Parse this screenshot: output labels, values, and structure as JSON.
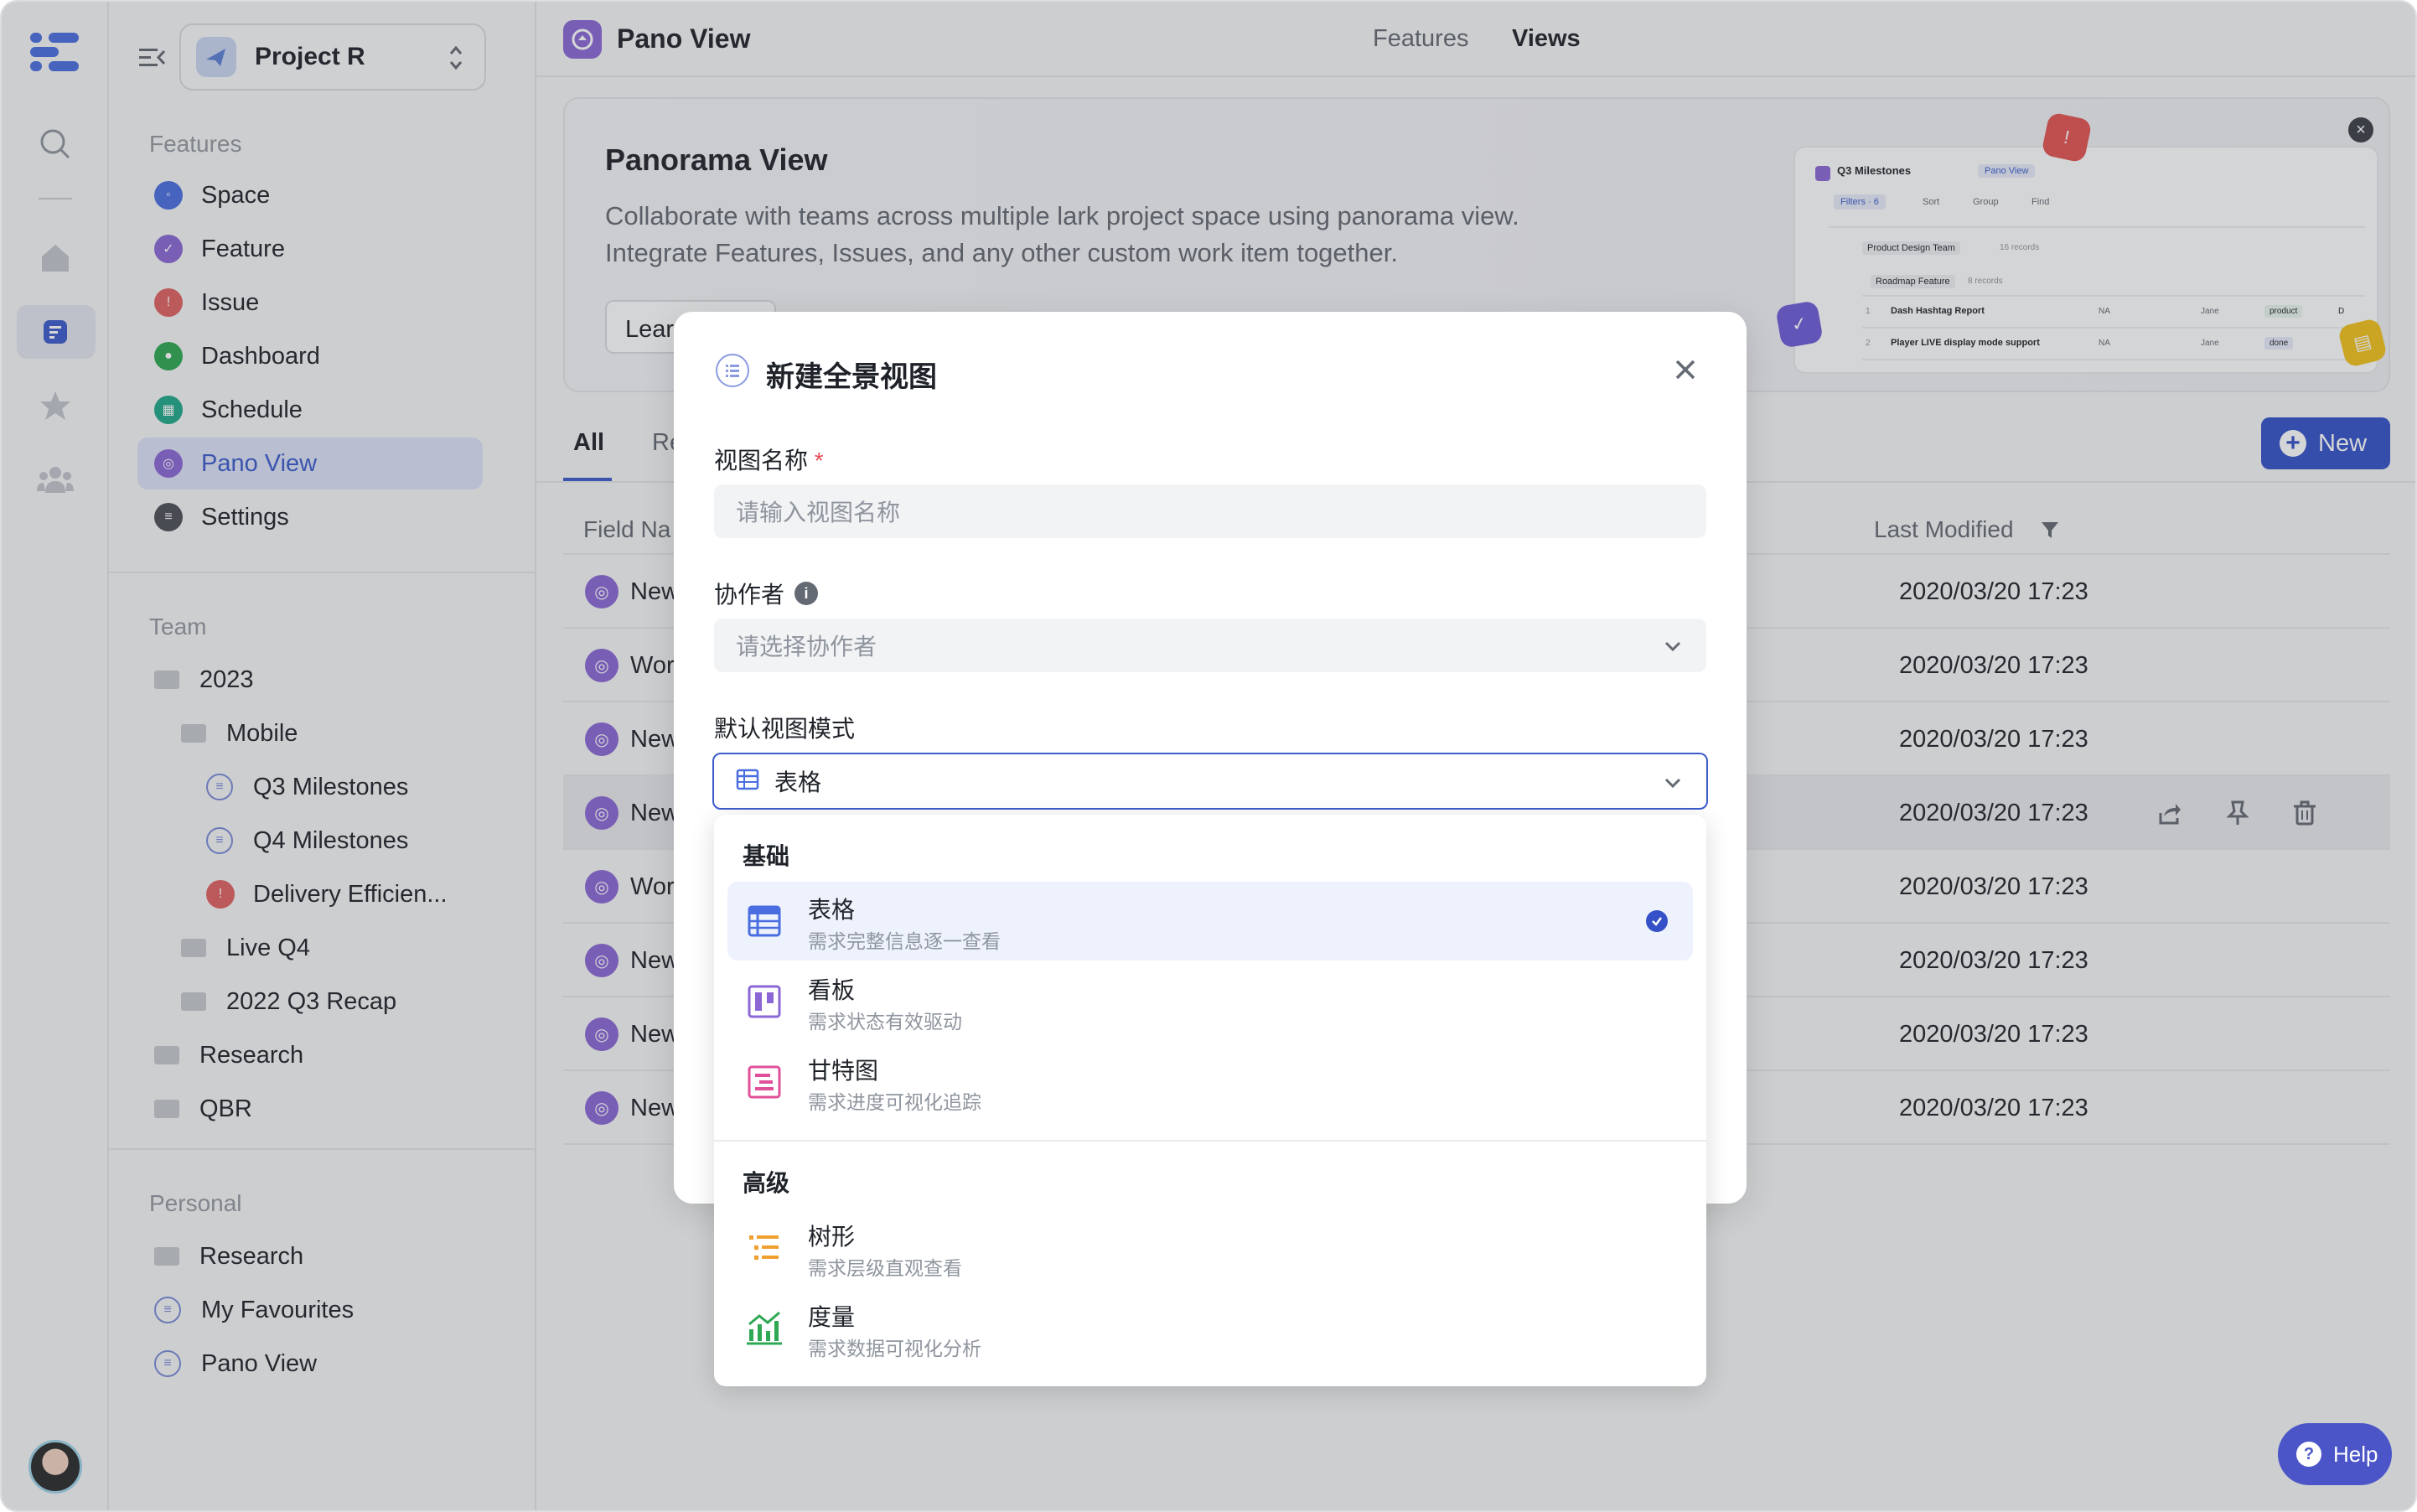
{
  "sidebar": {
    "project": "Project R",
    "features_header": "Features",
    "features": [
      {
        "label": "Space",
        "color": "#4a6ee0"
      },
      {
        "label": "Feature",
        "color": "#8b67d6"
      },
      {
        "label": "Issue",
        "color": "#e16060"
      },
      {
        "label": "Dashboard",
        "color": "#2ea853"
      },
      {
        "label": "Schedule",
        "color": "#1fa88a"
      },
      {
        "label": "Pano View",
        "color": "#8b67d6"
      },
      {
        "label": "Settings",
        "color": "#4c4f55"
      }
    ],
    "team_header": "Team",
    "team": {
      "y2023": "2023",
      "mobile": "Mobile",
      "q3": "Q3 Milestones",
      "q4": "Q4 Milestones",
      "delivery": "Delivery Efficien...",
      "live": "Live Q4",
      "recap": "2022 Q3 Recap",
      "research": "Research",
      "qbr": "QBR"
    },
    "personal_header": "Personal",
    "personal": {
      "research": "Research",
      "fav": "My Favourites",
      "pano": "Pano View"
    }
  },
  "topbar": {
    "title": "Pano View",
    "tab_features": "Features",
    "tab_views": "Views"
  },
  "banner": {
    "title": "Panorama View",
    "line1": "Collaborate with teams across multiple lark project space using panorama view.",
    "line2": "Integrate Features, Issues, and any other custom work item together.",
    "learn": "Lear",
    "preview": {
      "title": "Q3 Milestones",
      "badge": "Pano View",
      "filters": "Filters · 6",
      "sort": "Sort",
      "group": "Group",
      "find": "Find",
      "group1": "Product Design Team",
      "group1_count": "16 records",
      "group2": "Roadmap Feature",
      "group2_count": "8 records",
      "r1": "Dash Hashtag Report",
      "r2": "Player LIVE display mode support",
      "na": "NA",
      "jane": "Jane",
      "product": "product",
      "done": "done",
      "d": "D",
      "n1": "1",
      "n2": "2"
    }
  },
  "tabs": {
    "all": "All",
    "re": "Re"
  },
  "new_button": "New",
  "table": {
    "col_field": "Field Na",
    "col_modified": "Last Modified",
    "rows": [
      {
        "name": "New",
        "date": "2020/03/20 17:23"
      },
      {
        "name": "Wor",
        "date": "2020/03/20 17:23"
      },
      {
        "name": "New",
        "date": "2020/03/20 17:23"
      },
      {
        "name": "New",
        "date": "2020/03/20 17:23"
      },
      {
        "name": "Wor",
        "date": "2020/03/20 17:23"
      },
      {
        "name": "New",
        "date": "2020/03/20 17:23"
      },
      {
        "name": "New",
        "date": "2020/03/20 17:23"
      },
      {
        "name": "New",
        "date": "2020/03/20 17:23"
      }
    ]
  },
  "modal": {
    "title": "新建全景视图",
    "name_label": "视图名称",
    "required_mark": "*",
    "name_placeholder": "请输入视图名称",
    "collab_label": "协作者",
    "collab_placeholder": "请选择协作者",
    "mode_label": "默认视图模式",
    "mode_value": "表格"
  },
  "dropdown": {
    "basic": "基础",
    "advanced": "高级",
    "options": [
      {
        "title": "表格",
        "desc": "需求完整信息逐一查看",
        "icon": "table-icon",
        "color": "#4a6ee0"
      },
      {
        "title": "看板",
        "desc": "需求状态有效驱动",
        "icon": "kanban-icon",
        "color": "#8b67d6"
      },
      {
        "title": "甘特图",
        "desc": "需求进度可视化追踪",
        "icon": "gantt-icon",
        "color": "#e0509a"
      },
      {
        "title": "树形",
        "desc": "需求层级直观查看",
        "icon": "tree-icon",
        "color": "#f0a030"
      },
      {
        "title": "度量",
        "desc": "需求数据可视化分析",
        "icon": "chart-icon",
        "color": "#2ea853"
      }
    ]
  },
  "help": "Help"
}
